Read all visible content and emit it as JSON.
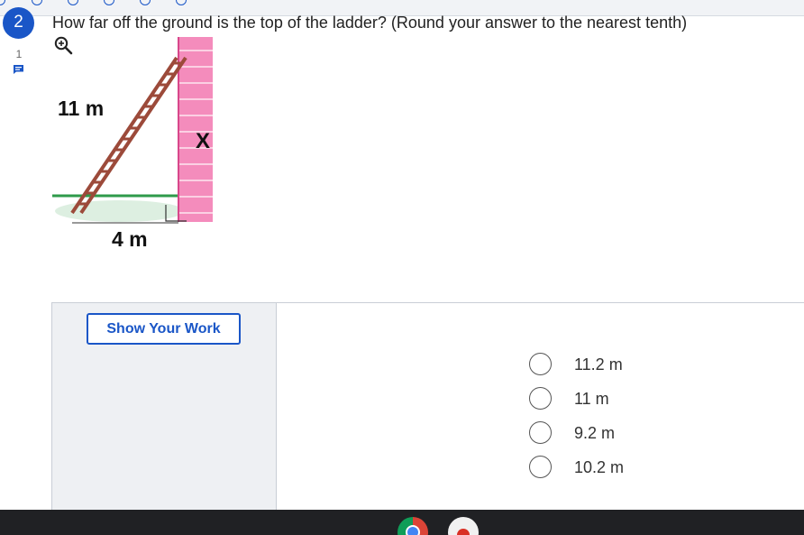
{
  "question": {
    "number": "2",
    "comment_count": "1",
    "text": "How far off the ground is the top of the ladder? (Round your answer to the nearest tenth)"
  },
  "figure": {
    "hypotenuse_label": "11 m",
    "height_label": "X",
    "base_label": "4 m"
  },
  "work": {
    "show_work_label": "Show Your Work"
  },
  "choices": [
    {
      "label": "11.2 m",
      "selected": false
    },
    {
      "label": "11 m",
      "selected": false
    },
    {
      "label": "9.2 m",
      "selected": false
    },
    {
      "label": "10.2 m",
      "selected": false
    }
  ],
  "colors": {
    "accent": "#1a56c7",
    "wall": "#f06aa8",
    "ladder": "#9c4a3a",
    "ground": "#2e9a4a"
  },
  "icons": {
    "zoom": "zoom-in-icon",
    "comment": "comment-icon",
    "taskbar_apps": [
      "chrome-icon",
      "app-icon"
    ]
  }
}
